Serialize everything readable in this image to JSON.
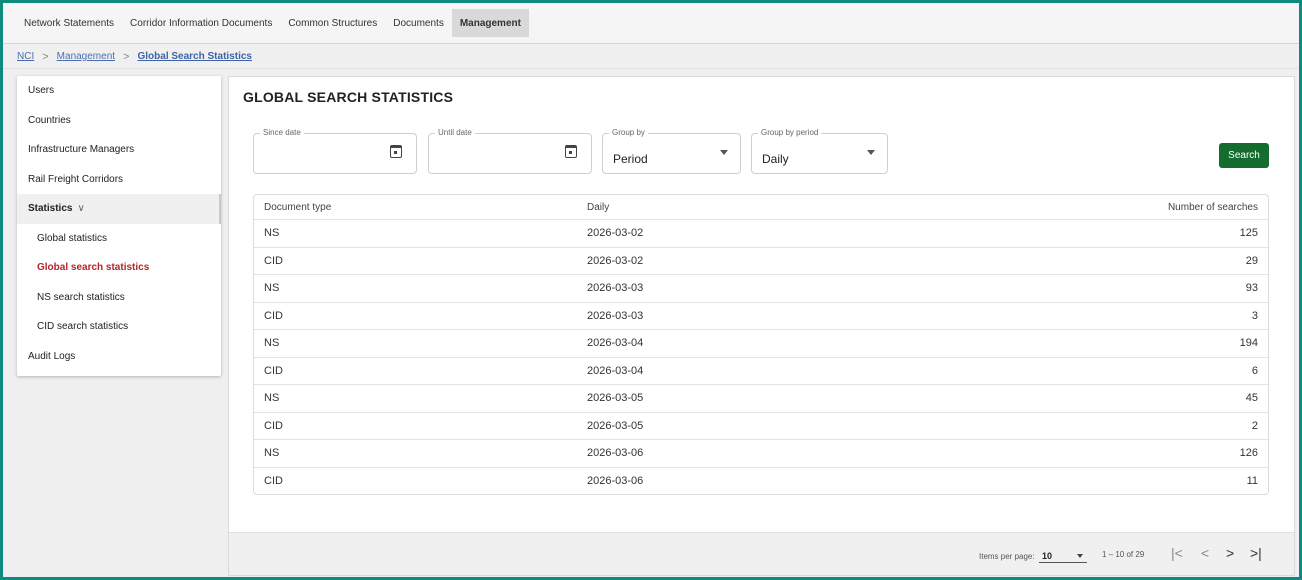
{
  "nav": {
    "tabs": [
      {
        "label": "Network Statements"
      },
      {
        "label": "Corridor Information Documents"
      },
      {
        "label": "Common Structures"
      },
      {
        "label": "Documents"
      },
      {
        "label": "Management"
      }
    ]
  },
  "breadcrumb": {
    "root": "NCI",
    "section": "Management",
    "current": "Global Search Statistics",
    "separator": ">"
  },
  "sidebar": {
    "items": [
      {
        "label": "Users"
      },
      {
        "label": "Countries"
      },
      {
        "label": "Infrastructure Managers"
      },
      {
        "label": "Rail Freight Corridors"
      },
      {
        "label": "Statistics",
        "chevron": "chevron-down-icon"
      },
      {
        "label": "Global statistics"
      },
      {
        "label": "Global search statistics"
      },
      {
        "label": "NS search statistics"
      },
      {
        "label": "CID search statistics"
      },
      {
        "label": "Audit Logs"
      }
    ]
  },
  "main": {
    "title": "GLOBAL SEARCH STATISTICS",
    "filters": {
      "since_label": "Since date",
      "since_value": "",
      "until_label": "Until date",
      "until_value": "",
      "group_by_label": "Group by",
      "group_by_value": "Period",
      "period_label": "Group by period",
      "period_value": "Daily"
    },
    "search_label": "Search",
    "table": {
      "headers": [
        "Document type",
        "Daily",
        "Number of searches"
      ],
      "rows": [
        [
          "NS",
          "2026-03-02",
          "125"
        ],
        [
          "CID",
          "2026-03-02",
          "29"
        ],
        [
          "NS",
          "2026-03-03",
          "93"
        ],
        [
          "CID",
          "2026-03-03",
          "3"
        ],
        [
          "NS",
          "2026-03-04",
          "194"
        ],
        [
          "CID",
          "2026-03-04",
          "6"
        ],
        [
          "NS",
          "2026-03-05",
          "45"
        ],
        [
          "CID",
          "2026-03-05",
          "2"
        ],
        [
          "NS",
          "2026-03-06",
          "126"
        ],
        [
          "CID",
          "2026-03-06",
          "11"
        ]
      ]
    },
    "paginator": {
      "items_label": "Items per page:",
      "page_size": "10",
      "range": "1 – 10 of 29",
      "first": "|<",
      "prev": "<",
      "next": ">",
      "last": ">|"
    }
  },
  "colors": {
    "frame": "#0e8a7e",
    "search_button": "#146c2e",
    "active_sidebar": "#b3262b",
    "link": "#4a6fb0"
  }
}
